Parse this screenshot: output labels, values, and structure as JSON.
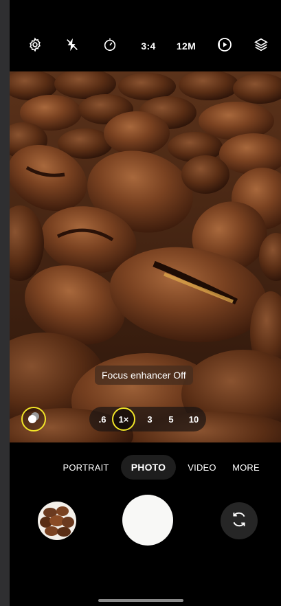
{
  "top_bar": {
    "items": [
      {
        "icon": "settings-icon"
      },
      {
        "icon": "flash-off-icon"
      },
      {
        "icon": "timer-icon"
      },
      {
        "label": "3:4"
      },
      {
        "label": "12M"
      },
      {
        "icon": "motion-photo-icon"
      },
      {
        "icon": "filters-icon"
      }
    ]
  },
  "viewfinder": {
    "toast": "Focus enhancer Off",
    "zoom": {
      "options": [
        ".6",
        "1×",
        "3",
        "5",
        "10"
      ],
      "selected": "1×"
    }
  },
  "modes": {
    "items": [
      "PORTRAIT",
      "PHOTO",
      "VIDEO",
      "MORE"
    ],
    "selected": "PHOTO"
  },
  "colors": {
    "accent": "#f2e628",
    "shutter": "#f8f8f6",
    "bean": "#6b3a1f"
  }
}
